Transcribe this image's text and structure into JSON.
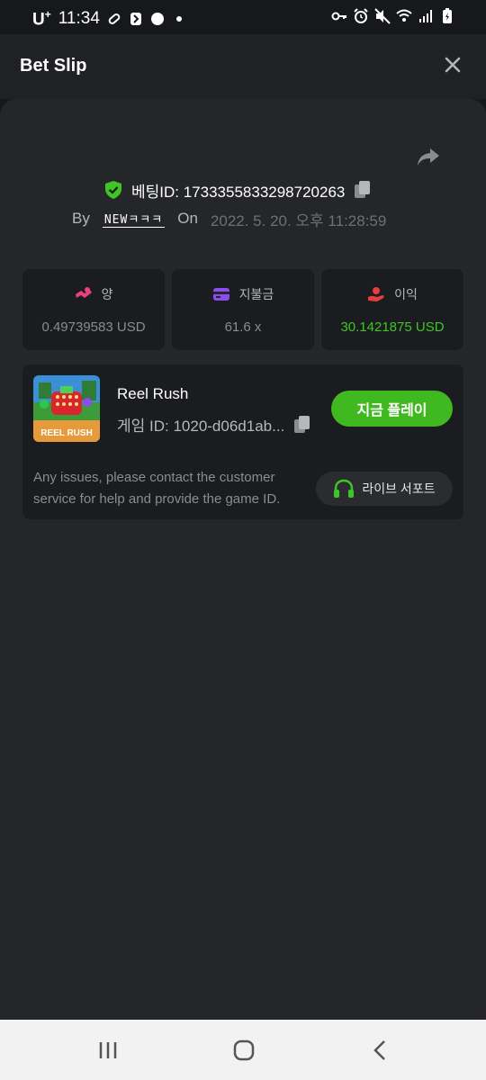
{
  "status": {
    "carrier": "U",
    "carrier_sup": "+",
    "time": "11:34"
  },
  "header": {
    "title": "Bet Slip"
  },
  "bet": {
    "id_label": "베팅ID: 1733355833298720263",
    "by_label": "By",
    "username": "NEWㅋㅋㅋ",
    "on_label": "On",
    "date": "2022. 5. 20. 오후 11:28:59"
  },
  "stats": [
    {
      "label": "양",
      "value": "0.49739583 USD",
      "icon": "coins-icon",
      "color": "#e8417b"
    },
    {
      "label": "지불금",
      "value": "61.6 x",
      "icon": "card-icon",
      "color": "#8b4cf0"
    },
    {
      "label": "이익",
      "value": "30.1421875 USD",
      "icon": "profit-hand-icon",
      "color": "#e83e3e"
    }
  ],
  "game": {
    "name": "Reel Rush",
    "id_label": "게임 ID: 1020-d06d1ab...",
    "thumb_caption": "REEL RUSH",
    "play_label": "지금 플레이",
    "support_text": "Any issues, please contact the customer service for help and provide the game ID.",
    "support_label": "라이브 서포트"
  },
  "colors": {
    "accent_green": "#3fb91f",
    "profit_green": "#3fc526",
    "background": "#17181b",
    "panel": "#25262a",
    "card": "#1b1c1f"
  }
}
